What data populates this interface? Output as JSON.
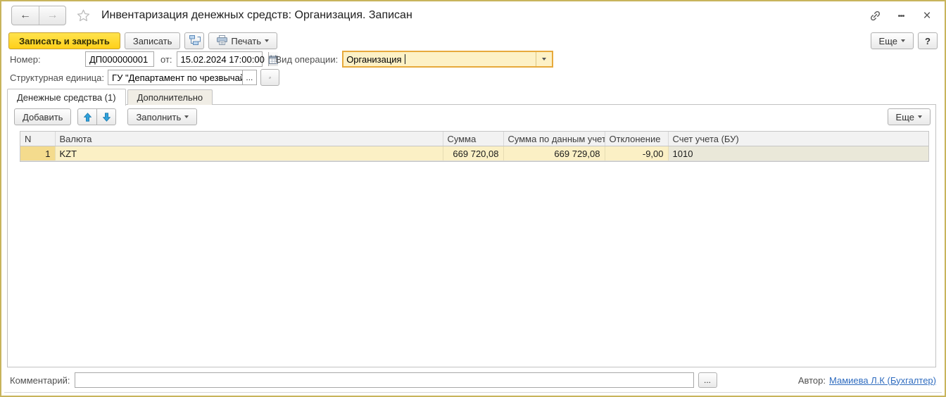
{
  "window": {
    "title": "Инвентаризация денежных средств: Организация. Записан",
    "border_color": "#c8b45c",
    "accent_yellow": "#ffd019",
    "focus_border": "#e7a93c",
    "focus_fill": "#fdf1c6",
    "selected_row_fill": "#fbf0c5",
    "link_color": "#2f6cbf"
  },
  "titlebar": {
    "back_icon": "←",
    "forward_icon": "→"
  },
  "toolbar": {
    "save_close_label": "Записать и закрыть",
    "save_label": "Записать",
    "print_label": "Печать",
    "more_label": "Еще",
    "help_label": "?"
  },
  "fields": {
    "number_label": "Номер:",
    "number_value": "ДП000000001",
    "date_label": "от:",
    "date_value": "15.02.2024 17:00:00",
    "operation_label": "Вид операции:",
    "operation_value": "Организация",
    "unit_label": "Структурная единица:",
    "unit_value": "ГУ \"Департамент по чрезвычайным",
    "ellipsis": "..."
  },
  "tabs": [
    {
      "label": "Денежные средства (1)"
    },
    {
      "label": "Дополнительно"
    }
  ],
  "table_toolbar": {
    "add_label": "Добавить",
    "fill_label": "Заполнить",
    "more_label": "Еще"
  },
  "table": {
    "columns": [
      "N",
      "Валюта",
      "Сумма",
      "Сумма по данным учета",
      "Отклонение",
      "Счет учета (БУ)"
    ],
    "rows": [
      {
        "n": "1",
        "currency": "KZT",
        "amount": "669 720,08",
        "amount_by_accounting": "669 729,08",
        "deviation": "-9,00",
        "account": "1010"
      }
    ]
  },
  "footer": {
    "comment_label": "Комментарий:",
    "comment_value": "",
    "ellipsis": "...",
    "author_label": "Автор:",
    "author_name": "Мамиева Л.К (Бухгалтер)"
  }
}
